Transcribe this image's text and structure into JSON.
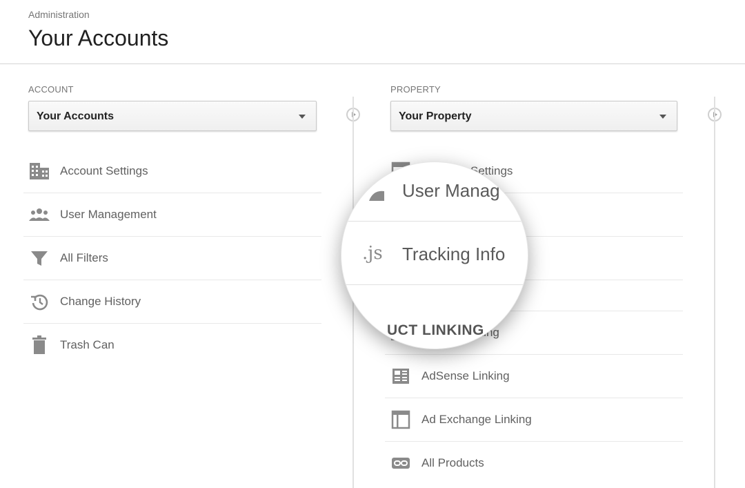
{
  "header": {
    "breadcrumb": "Administration",
    "title": "Your Accounts"
  },
  "account": {
    "label": "ACCOUNT",
    "selected": "Your Accounts",
    "items": [
      {
        "label": "Account Settings",
        "icon": "building-icon"
      },
      {
        "label": "User Management",
        "icon": "people-icon"
      },
      {
        "label": "All Filters",
        "icon": "filter-icon"
      },
      {
        "label": "Change History",
        "icon": "history-icon"
      },
      {
        "label": "Trash Can",
        "icon": "trash-icon"
      }
    ]
  },
  "property": {
    "label": "PROPERTY",
    "selected": "Your Property",
    "items_top": [
      {
        "label": "Settings",
        "icon": "settings-doc-icon"
      }
    ],
    "items_linking": [
      {
        "label": "Linking",
        "icon": "adwords-icon"
      },
      {
        "label": "AdSense Linking",
        "icon": "adsense-icon"
      },
      {
        "label": "Ad Exchange Linking",
        "icon": "adexchange-icon"
      },
      {
        "label": "All Products",
        "icon": "link-icon"
      }
    ]
  },
  "magnifier": {
    "user_management": "User Manag",
    "js_icon": ".js",
    "tracking_info": "Tracking Info",
    "linking_heading": "UCT LINKING"
  }
}
